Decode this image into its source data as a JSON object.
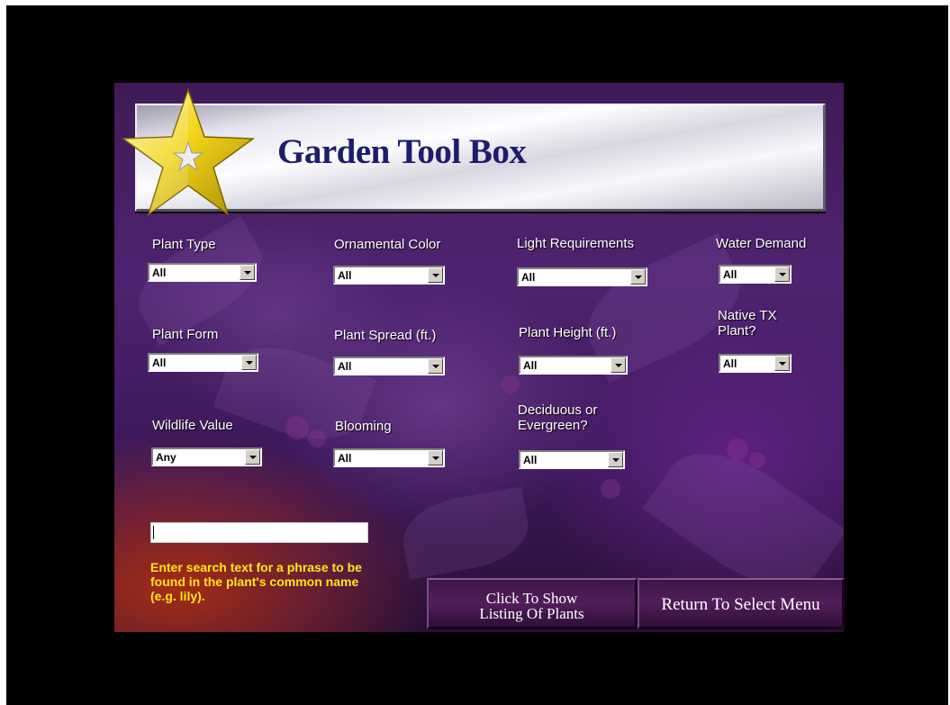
{
  "header": {
    "title": "Garden Tool Box"
  },
  "filters": [
    {
      "id": "plant-type",
      "label": "Plant Type",
      "value": "All"
    },
    {
      "id": "ornamental-color",
      "label": "Ornamental Color",
      "value": "All"
    },
    {
      "id": "light-requirements",
      "label": "Light Requirements",
      "value": "All"
    },
    {
      "id": "water-demand",
      "label": "Water Demand",
      "value": "All"
    },
    {
      "id": "plant-form",
      "label": "Plant Form",
      "value": "All"
    },
    {
      "id": "plant-spread",
      "label": "Plant Spread (ft.)",
      "value": "All"
    },
    {
      "id": "plant-height",
      "label": "Plant Height (ft.)",
      "value": "All"
    },
    {
      "id": "native-tx",
      "label": "Native TX Plant?",
      "value": "All"
    },
    {
      "id": "wildlife-value",
      "label": "Wildlife Value",
      "value": "Any"
    },
    {
      "id": "blooming",
      "label": "Blooming",
      "value": "All"
    },
    {
      "id": "deciduous-evergreen",
      "label": "Deciduous or Evergreen?",
      "value": "All"
    }
  ],
  "search": {
    "value": "",
    "hint": "Enter search text for a phrase to be found in the plant's common name (e.g. lily)."
  },
  "buttons": {
    "show_listing_line1": "Click To Show",
    "show_listing_line2": "Listing Of Plants",
    "return_menu": "Return To Select Menu"
  },
  "colors": {
    "title": "#1d1d6e",
    "hint": "#ffe819",
    "background_accent": "#4e2370",
    "star": "#f2d41a"
  },
  "icons": {
    "logo": "star-icon"
  }
}
